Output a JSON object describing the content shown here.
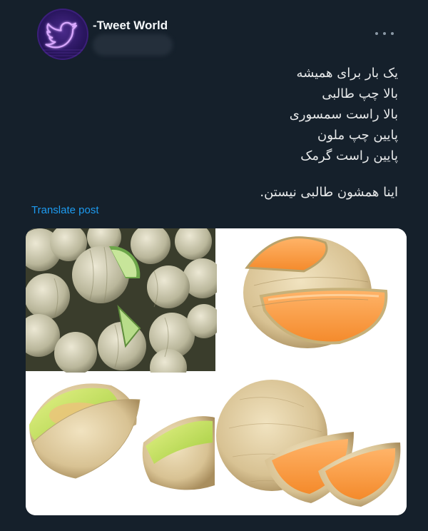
{
  "author": {
    "display_name": "-Tweet World",
    "avatar_icon": "twitter-bird-neon-icon"
  },
  "more_icon": "more-horizontal-icon",
  "tweet": {
    "lines": [
      "یک بار برای همیشه",
      "بالا چپ طالبی",
      "بالا راست سمسوری",
      "پایین چپ ملون",
      "پایین راست گرمک"
    ],
    "closing": "اینا همشون طالبی نیستن."
  },
  "translate_label": "Translate post",
  "media": {
    "panels": [
      "melon-pile-photo",
      "orange-cantaloupe-photo",
      "green-honeydew-photo",
      "netted-melon-slices-photo"
    ]
  },
  "colors": {
    "background": "#15202b",
    "link": "#1d9bf0",
    "text": "#e7e9ea",
    "muted": "#8b98a5"
  }
}
